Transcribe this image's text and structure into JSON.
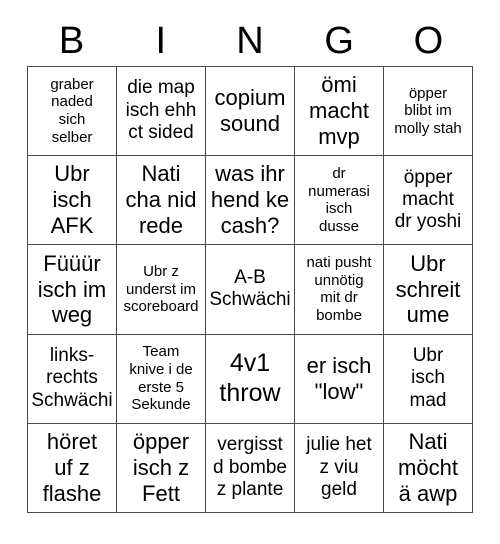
{
  "card": {
    "title": "BINGO",
    "header_letters": [
      "B",
      "I",
      "N",
      "G",
      "O"
    ],
    "border_color": "#4a4a4a",
    "background_color": "#ffffff",
    "text_color": "#000000",
    "rows": 5,
    "columns": 5,
    "cells": [
      {
        "text": "graber\nnaded\nsich\nselber",
        "size": "sm"
      },
      {
        "text": "die map\nisch ehh\nct sided",
        "size": "md"
      },
      {
        "text": "copium\nsound",
        "size": "lg"
      },
      {
        "text": "ömi\nmacht\nmvp",
        "size": "lg"
      },
      {
        "text": "öpper\nblibt im\nmolly stah",
        "size": "sm"
      },
      {
        "text": "Ubr\nisch\nAFK",
        "size": "lg"
      },
      {
        "text": "Nati\ncha nid\nrede",
        "size": "lg"
      },
      {
        "text": "was ihr\nhend ke\ncash?",
        "size": "lg"
      },
      {
        "text": "dr\nnumerasi\nisch\ndusse",
        "size": "sm"
      },
      {
        "text": "öpper\nmacht\ndr yoshi",
        "size": "md"
      },
      {
        "text": "Füüür\nisch im\nweg",
        "size": "lg"
      },
      {
        "text": "Ubr z\nunderst im\nscoreboard",
        "size": "sm"
      },
      {
        "text": "A-B\nSchwächi",
        "size": "md"
      },
      {
        "text": "nati pusht\nunnötig\nmit dr\nbombe",
        "size": "sm"
      },
      {
        "text": "Ubr\nschreit\nume",
        "size": "lg"
      },
      {
        "text": "links-\nrechts\nSchwächi",
        "size": "md"
      },
      {
        "text": "Team\nknive i de\nerste 5\nSekunde",
        "size": "sm"
      },
      {
        "text": "4v1\nthrow",
        "size": "xl"
      },
      {
        "text": "er isch\n\"low\"",
        "size": "lg"
      },
      {
        "text": "Ubr\nisch\nmad",
        "size": "md"
      },
      {
        "text": "höret\nuf z\nflashe",
        "size": "lg"
      },
      {
        "text": "öpper\nisch z\nFett",
        "size": "lg"
      },
      {
        "text": "vergisst\nd bombe\nz plante",
        "size": "md"
      },
      {
        "text": "julie het\nz viu\ngeld",
        "size": "md"
      },
      {
        "text": "Nati\nmöcht\nä awp",
        "size": "lg"
      }
    ]
  }
}
